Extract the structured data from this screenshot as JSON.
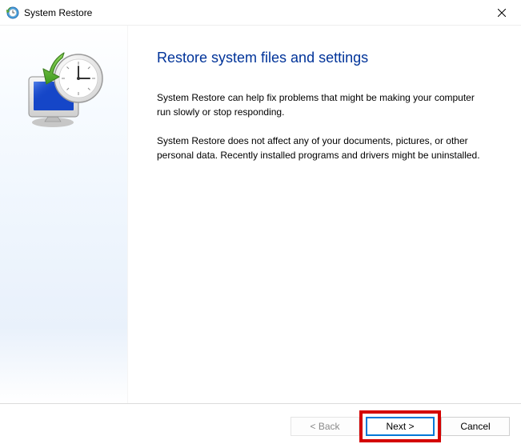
{
  "window": {
    "title": "System Restore"
  },
  "main": {
    "heading": "Restore system files and settings",
    "paragraph1": "System Restore can help fix problems that might be making your computer run slowly or stop responding.",
    "paragraph2": "System Restore does not affect any of your documents, pictures, or other personal data. Recently installed programs and drivers might be uninstalled."
  },
  "footer": {
    "back_label": "< Back",
    "next_label": "Next >",
    "cancel_label": "Cancel"
  }
}
